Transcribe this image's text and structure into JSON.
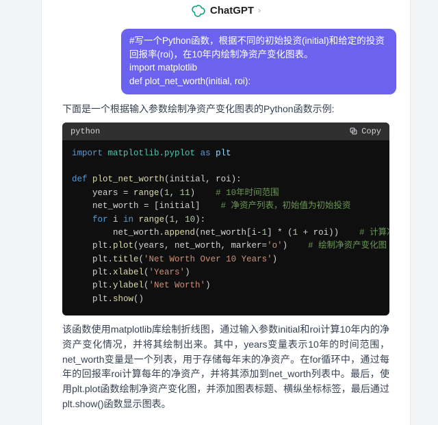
{
  "header": {
    "title": "ChatGPT",
    "chevron": "›",
    "logo_name": "chatgpt-logo"
  },
  "user_bubble": {
    "line1": "#写一个Python函数，根据不同的初始投资(initial)和给定的投资回报率(roi)，在10年内绘制净资产变化图表。",
    "line2": "import matplotlib",
    "line3": "def plot_net_worth(initial, roi):"
  },
  "assistant_intro": "下面是一个根据输入参数绘制净资产变化图表的Python函数示例:",
  "codeblock": {
    "lang": "python",
    "copy_label": "Copy"
  },
  "code": {
    "l1": {
      "import": "import",
      "mod": "matplotlib.pyplot",
      "as": "as",
      "alias": "plt"
    },
    "l2": {
      "def": "def",
      "fn": "plot_net_worth",
      "args": "(initial, roi):"
    },
    "l3": {
      "pre": "    years = ",
      "fn": "range",
      "args": "(",
      "n1": "1",
      "c": ", ",
      "n2": "11",
      "close": ")",
      "cmt": "    # 10年时间范围"
    },
    "l4": {
      "pre": "    net_worth = [initial]",
      "cmt": "    # 净资产列表，初始值为初始投资"
    },
    "l5": {
      "for": "for",
      "i": " i ",
      "in": "in",
      "sp": " ",
      "fn": "range",
      "args": "(",
      "n1": "1",
      "c": ", ",
      "n2": "10",
      "close": "):"
    },
    "l6": {
      "pre": "        net_worth.",
      "fn": "append",
      "args": "(net_worth[i-",
      "n1": "1",
      "mid": "] * (",
      "n2": "1",
      "mid2": " + roi))",
      "cmt": "    # 计算净资产，每"
    },
    "l7": {
      "pre": "    plt.",
      "fn": "plot",
      "args": "(years, net_worth, marker=",
      "str": "'o'",
      "close": ")",
      "cmt": "    # 绘制净资产变化图"
    },
    "l8": {
      "pre": "    plt.",
      "fn": "title",
      "args": "(",
      "str": "'Net Worth Over 10 Years'",
      "close": ")"
    },
    "l9": {
      "pre": "    plt.",
      "fn": "xlabel",
      "args": "(",
      "str": "'Years'",
      "close": ")"
    },
    "l10": {
      "pre": "    plt.",
      "fn": "ylabel",
      "args": "(",
      "str": "'Net Worth'",
      "close": ")"
    },
    "l11": {
      "pre": "    plt.",
      "fn": "show",
      "args": "()"
    }
  },
  "explain": "该函数使用matplotlib库绘制折线图，通过输入参数initial和roi计算10年内的净资产变化情况，并将其绘制出来。其中，years变量表示10年的时间范围，net_worth变量是一个列表，用于存储每年末的净资产。在for循环中，通过每年的回报率roi计算每年的净资产，并将其添加到net_worth列表中。最后，使用plt.plot函数绘制净资产变化图，并添加图表标题、横纵坐标标签，最后通过plt.show()函数显示图表。"
}
